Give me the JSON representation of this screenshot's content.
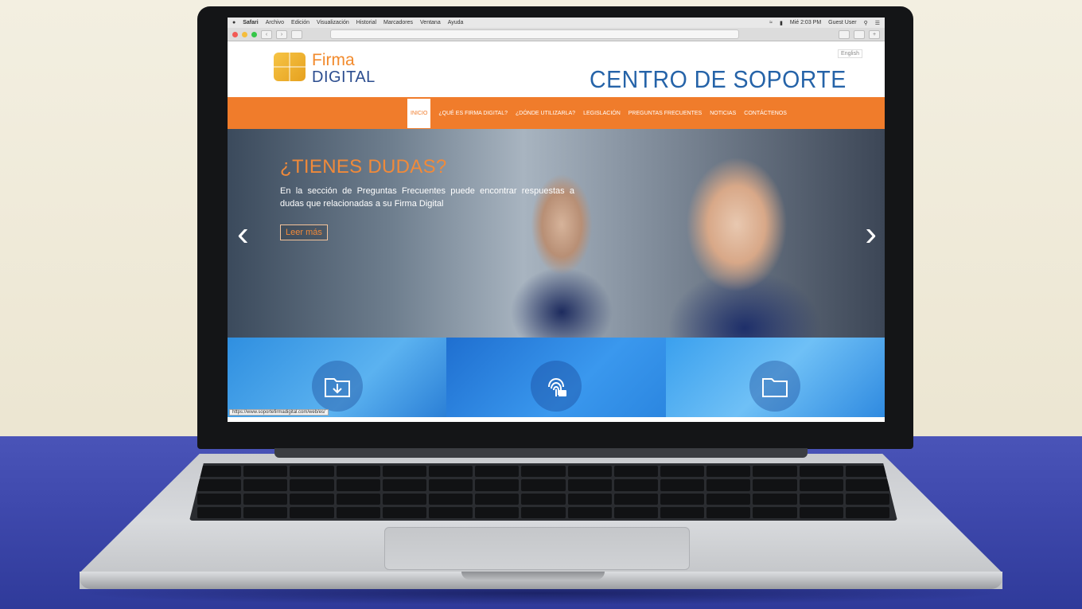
{
  "menubar": {
    "app": "Safari",
    "items": [
      "Archivo",
      "Edición",
      "Visualización",
      "Historial",
      "Marcadores",
      "Ventana",
      "Ayuda"
    ],
    "clock": "Mié 2:03 PM",
    "user": "Guest User"
  },
  "header": {
    "logo_line1": "Firma",
    "logo_line2": "DIGITAL",
    "title": "CENTRO DE SOPORTE",
    "language": "English"
  },
  "nav": {
    "items": [
      "INICIO",
      "¿QUÉ ES FIRMA DIGITAL?",
      "¿DÓNDE UTILIZARLA?",
      "LEGISLACIÓN",
      "PREGUNTAS FRECUENTES",
      "NOTICIAS",
      "CONTÁCTENOS"
    ]
  },
  "hero": {
    "title": "¿TIENES DUDAS?",
    "text": "En la sección de Preguntas Frecuentes puede encontrar respuestas a dudas que relacionadas a su Firma Digital",
    "button": "Leer más",
    "prev": "‹",
    "next": "›"
  },
  "status_url": "https://www.soportefirmadigital.com/web/es/",
  "colors": {
    "brand_orange": "#f07c2b",
    "brand_blue": "#2563a8",
    "desk_blue": "#3f49ad"
  },
  "icons": [
    "download-folder-icon",
    "fingerprint-lock-icon",
    "folder-icon"
  ]
}
